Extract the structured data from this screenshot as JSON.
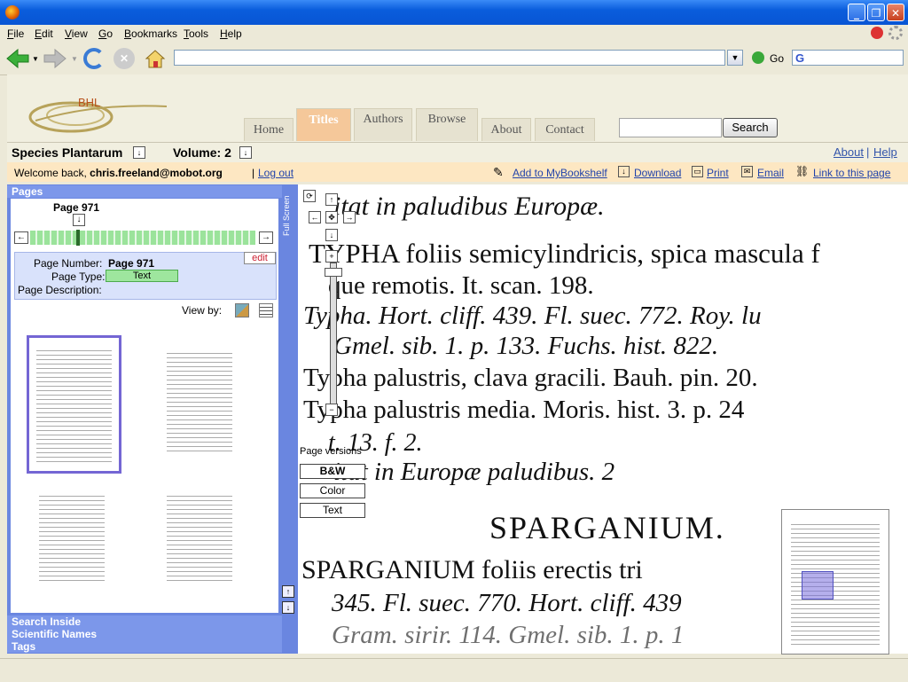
{
  "menubar": {
    "items": [
      {
        "label": "File",
        "accel": "F",
        "rest": "ile"
      },
      {
        "label": "Edit",
        "accel": "E",
        "rest": "dit"
      },
      {
        "label": "View",
        "accel": "V",
        "rest": "iew"
      },
      {
        "label": "Go",
        "accel": "G",
        "rest": "o"
      },
      {
        "label": "Bookmarks",
        "accel": "B",
        "rest": "ookmarks"
      },
      {
        "label": "Tools",
        "accel": "T",
        "rest": "ools"
      },
      {
        "label": "Help",
        "accel": "H",
        "rest": "elp"
      }
    ]
  },
  "navbar": {
    "url": "",
    "go_label": "Go",
    "search_value": ""
  },
  "site": {
    "logo_text": "BHL",
    "tabs": [
      "Home",
      "Titles",
      "Authors",
      "Browse",
      "About",
      "Contact"
    ],
    "search_value": "",
    "search_button": "Search"
  },
  "bookbar": {
    "title": "Species Plantarum",
    "volume": "Volume: 2",
    "about_link": "About",
    "separator": "|",
    "help_link": "Help"
  },
  "welcome": {
    "prefix": "Welcome back,",
    "user": "chris.freeland@mobot.org",
    "separator": "|",
    "logout": "Log out",
    "actions": [
      "Add to MyBookshelf",
      "Download",
      "Print",
      "Email",
      "Link to this page"
    ]
  },
  "sidebar": {
    "header": "Pages",
    "current_page": "Page 971",
    "edit_label": "edit",
    "page_number_label": "Page Number:",
    "page_number_value": "Page 971",
    "page_type_label": "Page Type:",
    "page_type_value": "Text",
    "page_description_label": "Page Description:",
    "view_by_label": "View by:",
    "sections": [
      "Search Inside",
      "Scientific Names",
      "Tags"
    ]
  },
  "viewer": {
    "fullscreen_label": "Full Screen",
    "page_versions_label": "Page versions",
    "versions": [
      "B&W",
      "Color",
      "Text"
    ],
    "page_text": [
      "itat in paludibus Europæ.",
      "TYPHA foliis semicylindricis, spica mascula f",
      "que remotis. It. scan. 198.",
      "Typha. Hort. cliff. 439. Fl. suec. 772. Roy. lu",
      "Gmel. sib. 1. p. 133. Fuchs. hist. 822.",
      "Typha palustris, clava gracili. Bauh. pin. 20.",
      "Typha palustris media. Moris. hist. 3. p. 24",
      "t. 13. f. 2.",
      "itat in Europæ paludibus. 2",
      "SPARGANIUM.",
      "SPARGANIUM foliis erectis tri",
      "345. Fl. suec. 770. Hort. cliff. 439",
      "Gram. sirir. 114. Gmel. sib. 1. p. 1"
    ]
  },
  "colors": {
    "sidebar_blue": "#6a86e0",
    "active_tab": "#f5c89a",
    "welcome_bg": "#fde7c2",
    "page_type_green": "#9ee69e",
    "thumb_selected": "#7466d4"
  }
}
